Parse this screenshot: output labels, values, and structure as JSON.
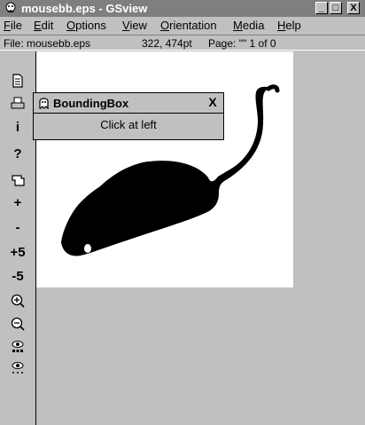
{
  "window": {
    "title": "mousebb.eps - GSview",
    "minimize_label": "_",
    "maximize_label": "□",
    "close_label": "X"
  },
  "menu": [
    {
      "underline": "F",
      "rest": "ile"
    },
    {
      "underline": "E",
      "rest": "dit"
    },
    {
      "underline": "O",
      "rest": "ptions"
    },
    {
      "underline": "V",
      "rest": "iew"
    },
    {
      "underline": "O",
      "rest": "rientation"
    },
    {
      "underline": "M",
      "rest": "edia"
    },
    {
      "underline": "H",
      "rest": "elp"
    }
  ],
  "status": {
    "file": "File: mousebb.eps",
    "coords": "322, 474pt",
    "page": "Page: \"\"  1 of 0"
  },
  "toolbar": {
    "info": "i",
    "help": "?",
    "zoom_in_label": "+",
    "zoom_out_label": "-",
    "plus5": "+5",
    "minus5": "-5"
  },
  "dialog": {
    "title": "BoundingBox",
    "close_label": "X",
    "message": "Click at left"
  }
}
